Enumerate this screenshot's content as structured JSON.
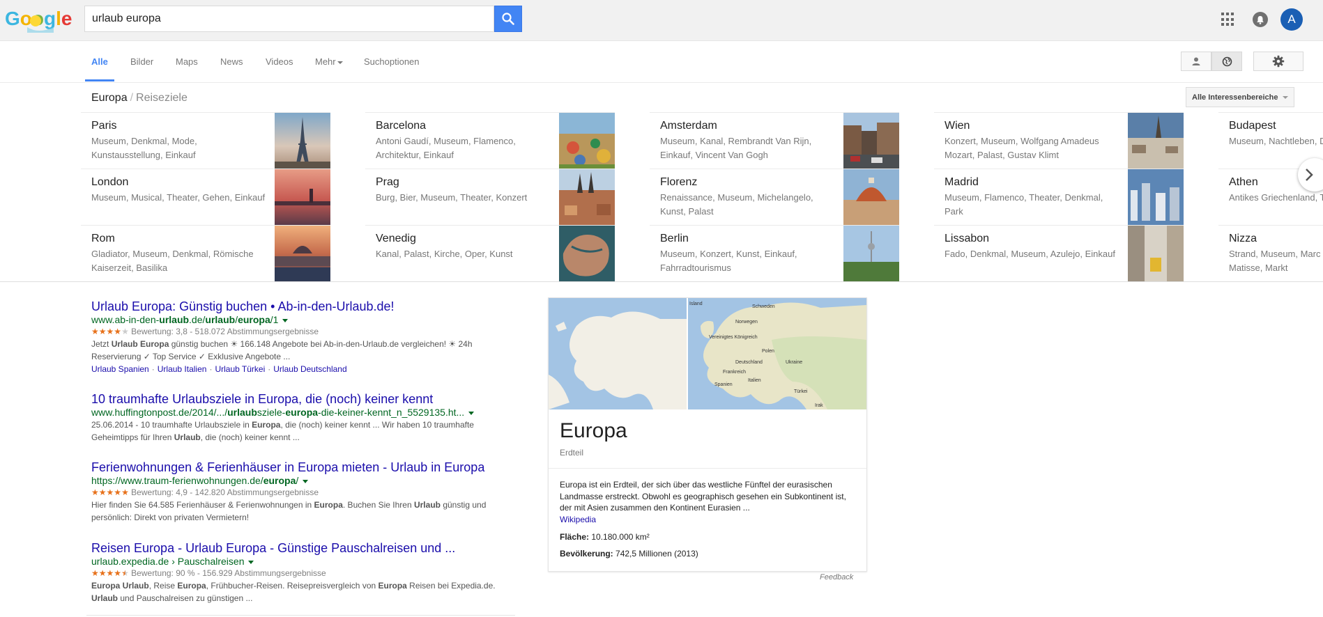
{
  "header": {
    "logo_text": "Google",
    "search_value": "urlaub europa",
    "avatar_letter": "A"
  },
  "nav": {
    "tabs": [
      "Alle",
      "Bilder",
      "Maps",
      "News",
      "Videos",
      "Mehr",
      "Suchoptionen"
    ],
    "active_tab": "Alle"
  },
  "carousel": {
    "breadcrumb_main": "Europa",
    "breadcrumb_separator": "/",
    "breadcrumb_sub": "Reiseziele",
    "filter_label": "Alle Interessenbereiche",
    "destinations": [
      {
        "name": "Paris",
        "desc": "Museum, Denkmal, Mode, Kunstausstellung, Einkauf"
      },
      {
        "name": "Barcelona",
        "desc": "Antoni Gaudí, Museum, Flamenco, Architektur, Einkauf"
      },
      {
        "name": "Amsterdam",
        "desc": "Museum, Kanal, Rembrandt Van Rijn, Einkauf, Vincent Van Gogh"
      },
      {
        "name": "Wien",
        "desc": "Konzert, Museum, Wolfgang Amadeus Mozart, Palast, Gustav Klimt"
      },
      {
        "name": "Budapest",
        "desc": "Museum, Nachtleben, Denkmal"
      },
      {
        "name": "London",
        "desc": "Museum, Musical, Theater, Gehen, Einkauf"
      },
      {
        "name": "Prag",
        "desc": "Burg, Bier, Museum, Theater, Konzert"
      },
      {
        "name": "Florenz",
        "desc": "Renaissance, Museum, Michelangelo, Kunst, Palast"
      },
      {
        "name": "Madrid",
        "desc": "Museum, Flamenco, Theater, Denkmal, Park"
      },
      {
        "name": "Athen",
        "desc": "Antikes Griechenland, Theater, Tempel"
      },
      {
        "name": "Rom",
        "desc": "Gladiator, Museum, Denkmal, Römische Kaiserzeit, Basilika"
      },
      {
        "name": "Venedig",
        "desc": "Kanal, Palast, Kirche, Oper, Kunst"
      },
      {
        "name": "Berlin",
        "desc": "Museum, Konzert, Kunst, Einkauf, Fahrradtourismus"
      },
      {
        "name": "Lissabon",
        "desc": "Fado, Denkmal, Museum, Azulejo, Einkauf"
      },
      {
        "name": "Nizza",
        "desc": "Strand, Museum, Marc Chagall, Henri Matisse, Markt"
      }
    ]
  },
  "results": [
    {
      "title": "Urlaub Europa: Günstig buchen • Ab-in-den-Urlaub.de!",
      "url_parts": [
        [
          "www.ab-in-den-",
          false
        ],
        [
          "urlaub",
          true
        ],
        [
          ".de/",
          false
        ],
        [
          "urlaub",
          true
        ],
        [
          "/",
          false
        ],
        [
          "europa",
          true
        ],
        [
          "/1",
          false
        ]
      ],
      "stars": 3.8,
      "rating_text": "Bewertung: 3,8 - 518.072 Abstimmungsergebnisse",
      "snippet_parts": [
        [
          "Jetzt ",
          false
        ],
        [
          "Urlaub Europa",
          true
        ],
        [
          " günstig buchen ☀ 166.148 Angebote bei Ab-in-den-Urlaub.de vergleichen! ☀ 24h Reservierung ✓ Top Service ✓ Exklusive Angebote ...",
          false
        ]
      ],
      "sitelinks": [
        "Urlaub Spanien",
        "Urlaub Italien",
        "Urlaub Türkei",
        "Urlaub Deutschland"
      ]
    },
    {
      "title": "10 traumhafte Urlaubsziele in Europa, die (noch) keiner kennt",
      "url_parts": [
        [
          "www.huffingtonpost.de/2014/.../",
          false
        ],
        [
          "urlaub",
          true
        ],
        [
          "sziele-",
          false
        ],
        [
          "europa",
          true
        ],
        [
          "-die-keiner-kennt_n_5529135.ht...",
          false
        ]
      ],
      "stars": null,
      "rating_text": "",
      "snippet_parts": [
        [
          "25.06.2014 - 10 traumhafte Urlaubsziele in ",
          false
        ],
        [
          "Europa",
          true
        ],
        [
          ", die (noch) keiner kennt ... Wir haben 10 traumhafte Geheimtipps für Ihren ",
          false
        ],
        [
          "Urlaub",
          true
        ],
        [
          ", die (noch) keiner kennt ...",
          false
        ]
      ],
      "sitelinks": []
    },
    {
      "title": "Ferienwohnungen & Ferienhäuser in Europa mieten - Urlaub in Europa",
      "url_parts": [
        [
          "https://www.traum-ferienwohnungen.de/",
          false
        ],
        [
          "europa",
          true
        ],
        [
          "/",
          false
        ]
      ],
      "stars": 4.9,
      "rating_text": "Bewertung: 4,9 - 142.820 Abstimmungsergebnisse",
      "snippet_parts": [
        [
          "Hier finden Sie 64.585 Ferienhäuser & Ferienwohnungen in ",
          false
        ],
        [
          "Europa",
          true
        ],
        [
          ". Buchen Sie Ihren ",
          false
        ],
        [
          "Urlaub",
          true
        ],
        [
          " günstig und persönlich: Direkt von privaten Vermietern!",
          false
        ]
      ],
      "sitelinks": []
    },
    {
      "title": "Reisen Europa - Urlaub Europa - Günstige Pauschalreisen und ...",
      "url_parts": [
        [
          "urlaub.expedia.de › Pauschalreisen",
          false
        ]
      ],
      "stars": 4.5,
      "rating_text": "Bewertung: 90 % - 156.929 Abstimmungsergebnisse",
      "snippet_parts": [
        [
          "Europa Urlaub",
          true
        ],
        [
          ", Reise ",
          false
        ],
        [
          "Europa",
          true
        ],
        [
          ", Frühbucher-Reisen. Reisepreisvergleich von ",
          false
        ],
        [
          "Europa",
          true
        ],
        [
          " Reisen bei Expedia.de. ",
          false
        ],
        [
          "Urlaub",
          true
        ],
        [
          " und Pauschalreisen zu günstigen ...",
          false
        ]
      ],
      "sitelinks": []
    }
  ],
  "knowledge_panel": {
    "title": "Europa",
    "subtitle": "Erdteil",
    "description": "Europa ist ein Erdteil, der sich über das westliche Fünftel der eurasischen Landmasse erstreckt. Obwohl es geographisch gesehen ein Subkontinent ist, der mit Asien zusammen den Kontinent Eurasien ...",
    "source_label": "Wikipedia",
    "facts": [
      {
        "label": "Fläche:",
        "value": "10.180.000 km²"
      },
      {
        "label": "Bevölkerung:",
        "value": "742,5 Millionen (2013)"
      }
    ],
    "map_labels": [
      "Island",
      "Schweden",
      "Norwegen",
      "Vereinigtes Königreich",
      "Polen",
      "Deutschland",
      "Ukraine",
      "Frankreich",
      "Italien",
      "Spanien",
      "Türkei",
      "Irak"
    ],
    "feedback_label": "Feedback"
  },
  "colors": {
    "accent": "#4285f4",
    "link": "#1a0dab",
    "url": "#006621",
    "stars": "#e7711b"
  }
}
